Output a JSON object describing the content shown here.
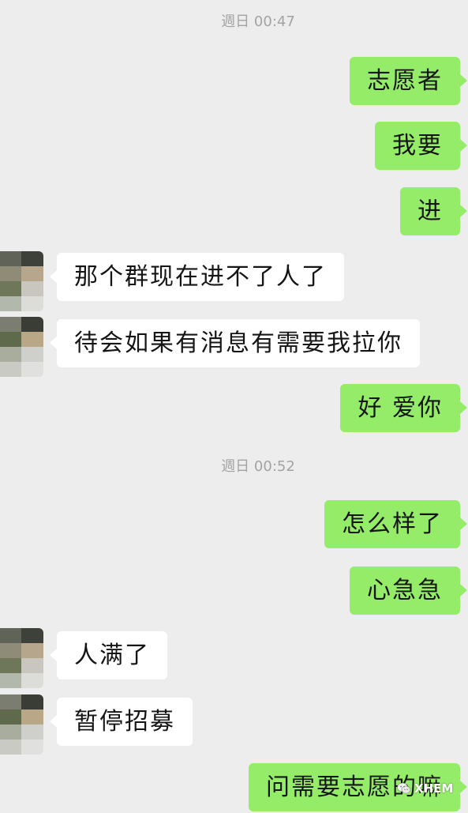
{
  "colors": {
    "background": "#ededed",
    "sent_bubble": "#95ec69",
    "received_bubble": "#ffffff",
    "timestamp_text": "#a3a3a3"
  },
  "chat": {
    "timeline": [
      {
        "timestamp": "週日 00:47"
      },
      {
        "sent": "志愿者"
      },
      {
        "sent": "我要"
      },
      {
        "sent": "进"
      },
      {
        "received": "那个群现在进不了人了"
      },
      {
        "received": "待会如果有消息有需要我拉你"
      },
      {
        "sent": "好 爱你"
      },
      {
        "timestamp": "週日 00:52"
      },
      {
        "sent": "怎么样了"
      },
      {
        "sent": "心急急"
      },
      {
        "received": "人满了"
      },
      {
        "received": "暂停招募"
      },
      {
        "sent": "问需要志愿的嘛"
      }
    ]
  },
  "watermark": {
    "icon": "wechat-icon",
    "text": "XHEM"
  }
}
